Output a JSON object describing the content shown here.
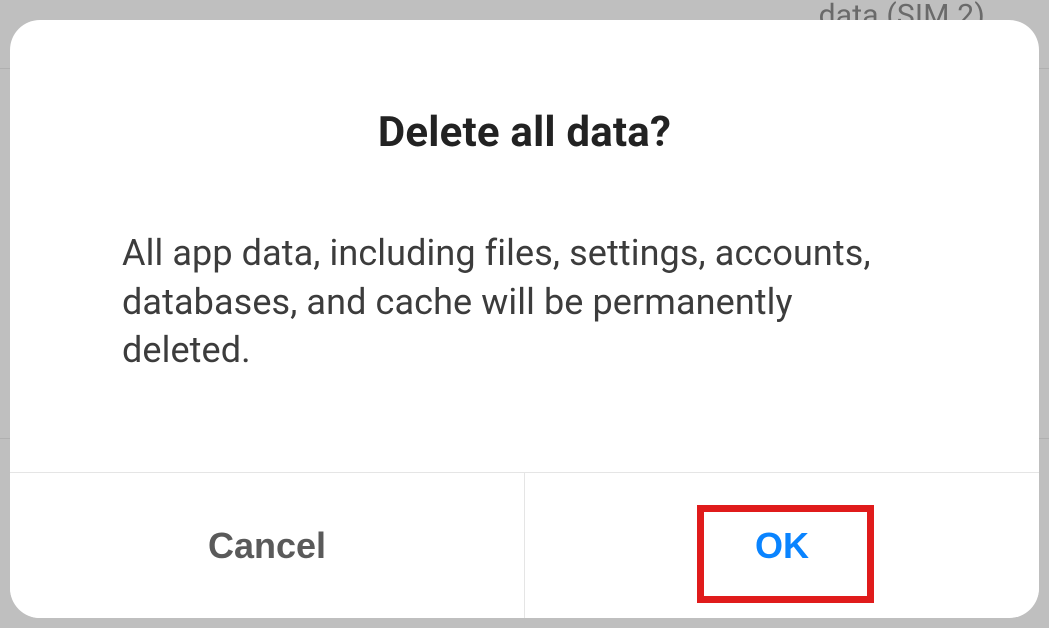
{
  "backdrop": {
    "partial_text": "data (SIM 2)"
  },
  "dialog": {
    "title": "Delete all data?",
    "message": "All app data, including files, settings, accounts, databases, and cache will be permanently deleted.",
    "buttons": {
      "cancel": "Cancel",
      "ok": "OK"
    }
  }
}
